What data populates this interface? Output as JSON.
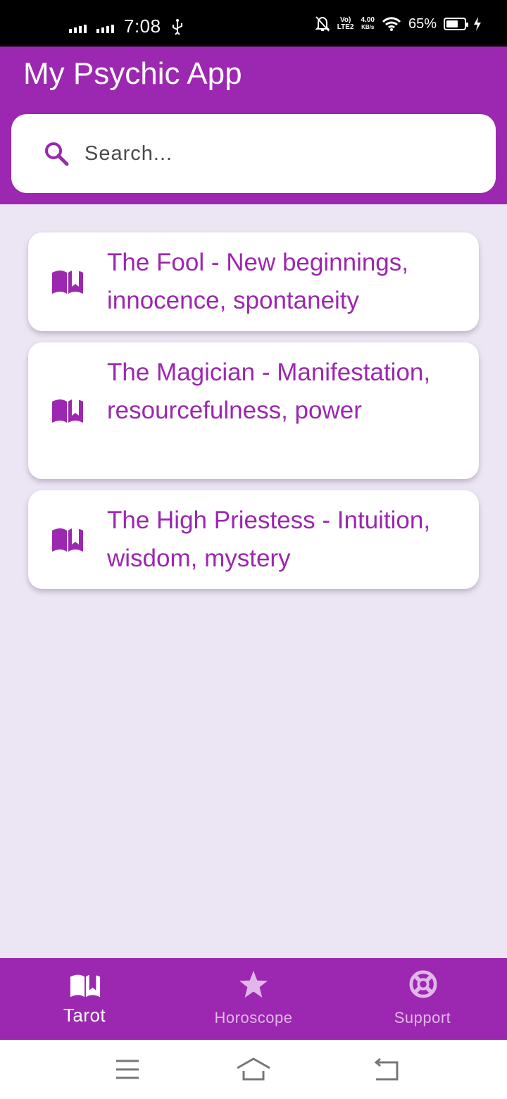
{
  "status_bar": {
    "time": "7:08",
    "volte": "Vo)",
    "lte": "LTE2",
    "speed_value": "4.00",
    "speed_unit": "KB/s",
    "battery_pct": "65%",
    "battery_level": 0.65
  },
  "app": {
    "title": "My Psychic App",
    "accent_color": "#9c27b0",
    "background_color": "#ece6f4"
  },
  "search": {
    "placeholder": "Search..."
  },
  "cards": [
    {
      "icon": "book-icon",
      "text": "The Fool - New beginnings, innocence, spontaneity"
    },
    {
      "icon": "book-icon",
      "text": "The Magician - Manifestation, resourcefulness, power"
    },
    {
      "icon": "book-icon",
      "text": "The High Priestess - Intuition, wisdom, mystery"
    }
  ],
  "bottom_nav": {
    "items": [
      {
        "label": "Tarot",
        "icon": "book-icon",
        "active": true
      },
      {
        "label": "Horoscope",
        "icon": "star-icon",
        "active": false
      },
      {
        "label": "Support",
        "icon": "lifebuoy-icon",
        "active": false
      }
    ]
  },
  "system_nav": {
    "buttons": [
      "menu-icon",
      "home-icon",
      "back-icon"
    ]
  }
}
